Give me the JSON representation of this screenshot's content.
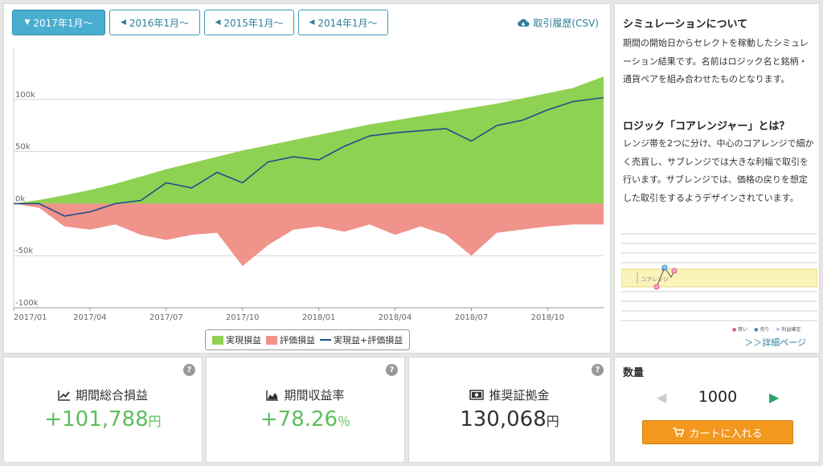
{
  "range_buttons": [
    {
      "label": "2017年1月～",
      "active": true
    },
    {
      "label": "2016年1月～",
      "active": false
    },
    {
      "label": "2015年1月～",
      "active": false
    },
    {
      "label": "2014年1月～",
      "active": false
    }
  ],
  "csv_link": "取引履歴(CSV)",
  "colors": {
    "realized": "#8fd152",
    "unrealized": "#f0938a",
    "total": "#1f4e8c",
    "accent": "#4aaed0",
    "cart": "#f3981e"
  },
  "chart_data": {
    "type": "area",
    "y_ticks": [
      "100k",
      "50k",
      "0k",
      "-50k",
      "-100k"
    ],
    "y_tick_values": [
      100000,
      50000,
      0,
      -50000,
      -100000
    ],
    "x_ticks": [
      "2017/01",
      "2017/04",
      "2017/07",
      "2017/10",
      "2018/01",
      "2018/04",
      "2018/07",
      "2018/10"
    ],
    "ylim": [
      -100000,
      150000
    ],
    "xlim": [
      0,
      23.2
    ],
    "grid": true,
    "legend_position": "bottom-center",
    "x": [
      0,
      1,
      2,
      3,
      4,
      5,
      6,
      7,
      8,
      9,
      10,
      11,
      12,
      13,
      14,
      15,
      16,
      17,
      18,
      19,
      20,
      21,
      22,
      23.2
    ],
    "series": [
      {
        "name": "実現損益",
        "values": [
          0,
          3500,
          8000,
          13000,
          19000,
          26000,
          33000,
          39000,
          45000,
          51000,
          56000,
          61000,
          66000,
          71000,
          76000,
          80000,
          84000,
          88000,
          92000,
          96000,
          101000,
          106000,
          111000,
          122000
        ]
      },
      {
        "name": "評価損益",
        "values": [
          0,
          -4000,
          -22000,
          -25000,
          -20000,
          -30000,
          -35000,
          -30000,
          -28000,
          -60000,
          -40000,
          -25000,
          -22000,
          -27000,
          -20000,
          -30000,
          -22000,
          -30000,
          -50000,
          -28000,
          -25000,
          -22000,
          -20000,
          -20000
        ]
      },
      {
        "name": "実現益+評価損益",
        "values": [
          0,
          0,
          -12000,
          -8000,
          0,
          3000,
          20000,
          15000,
          30000,
          20000,
          40000,
          45000,
          42000,
          55000,
          65000,
          68000,
          70000,
          72000,
          60000,
          75000,
          80000,
          90000,
          98000,
          101788
        ]
      }
    ]
  },
  "info": {
    "title": "シミュレーションについて",
    "body": "期間の開始日からセレクトを稼動したシミュレーション結果です。名前はロジック名と銘柄・通貨ペアを組み合わせたものとなります。",
    "logic_title": "ロジック「コアレンジャー」とは？",
    "logic_body": "レンジ帯を2つに分け、中心のコアレンジで細かく売買し、サブレンジでは大きな利幅で取引を行います。サブレンジでは、価格の戻りを想定した取引をするようデザインされています。",
    "diagram_label": "コアレンジ",
    "diagram_legend": [
      "買い",
      "売り",
      "利益確定"
    ],
    "detail_link": "＞＞詳細ページ"
  },
  "stats": [
    {
      "label": "期間総合損益",
      "value": "+101,788",
      "unit": "円",
      "icon": "line-chart-icon",
      "help": "?"
    },
    {
      "label": "期間収益率",
      "value": "+78.26",
      "unit": "％",
      "icon": "area-chart-icon",
      "help": "?"
    },
    {
      "label": "推奨証拠金",
      "value": "130,068",
      "unit": "円",
      "icon": "money-icon",
      "help": "?"
    }
  ],
  "quantity": {
    "title": "数量",
    "value": "1000",
    "cart_label": "カートに入れる"
  }
}
